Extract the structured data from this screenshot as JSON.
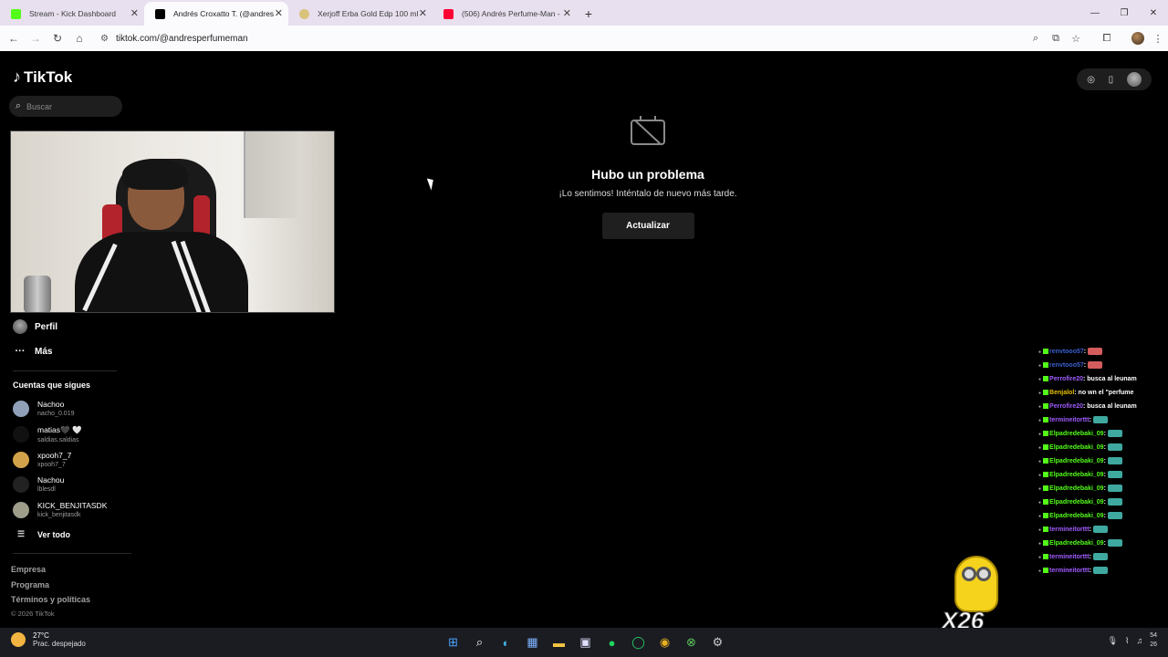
{
  "browser": {
    "tabs": [
      {
        "title": "Stream - Kick Dashboard",
        "favicon_color": "#53fc18",
        "active": false
      },
      {
        "title": "Andrés Croxatto T. (@andrespe",
        "favicon_color": "#000000",
        "active": true
      },
      {
        "title": "Xerjoff Erba Gold Edp 100 ml |",
        "favicon_color": "#d9c27a",
        "active": false
      },
      {
        "title": "(506) Andrés Perfume-Man - Yo",
        "favicon_color": "#ff0033",
        "active": false
      }
    ],
    "new_tab": "+",
    "url": "tiktok.com/@andresperfumeman"
  },
  "tiktok": {
    "logo_text": "TikTok",
    "search_placeholder": "Buscar",
    "nav": {
      "profile": "Perfil",
      "more": "Más"
    },
    "following_title": "Cuentas que sigues",
    "following": [
      {
        "name": "Nachoo",
        "handle": "nacho_0.019",
        "avatar_color": "#8fa0b8"
      },
      {
        "name": "matias🖤 🤍",
        "handle": "saldias.saldias",
        "avatar_color": "#111111"
      },
      {
        "name": "xpooh7_7",
        "handle": "xpooh7_7",
        "avatar_color": "#d2a24a"
      },
      {
        "name": "Nachou",
        "handle": "lblesdl",
        "avatar_color": "#222222"
      },
      {
        "name": "KICK_BENJITASDK",
        "handle": "kick_benjitasdk",
        "avatar_color": "#9d9d8a"
      }
    ],
    "see_all": "Ver todo",
    "footer": {
      "links": [
        "Empresa",
        "Programa",
        "Términos y políticas"
      ],
      "copyright": "© 2026 TikTok"
    },
    "error": {
      "title": "Hubo un problema",
      "message": "¡Lo sentimos! Inténtalo de nuevo más tarde.",
      "button": "Actualizar"
    }
  },
  "chat": [
    {
      "user": "renvtooo57",
      "color": "#3a5fcd",
      "text": ":"
    },
    {
      "user": "renvtooo57",
      "color": "#3a5fcd",
      "text": ":"
    },
    {
      "user": "Perrofire20",
      "color": "#a05cff",
      "text": ": busca al leunam"
    },
    {
      "user": "Benjalol",
      "color": "#e5c100",
      "text": ": no wn el \"perfume"
    },
    {
      "user": "Perrofire20",
      "color": "#a05cff",
      "text": ": busca al leunam"
    },
    {
      "user": "termineitorttt",
      "color": "#a05cff",
      "text": ":"
    },
    {
      "user": "Elpadredebaki_09",
      "color": "#53fc18",
      "text": ":"
    },
    {
      "user": "Elpadredebaki_09",
      "color": "#53fc18",
      "text": ":"
    },
    {
      "user": "Elpadredebaki_09",
      "color": "#53fc18",
      "text": ":"
    },
    {
      "user": "Elpadredebaki_09",
      "color": "#53fc18",
      "text": ":"
    },
    {
      "user": "Elpadredebaki_09",
      "color": "#53fc18",
      "text": ":"
    },
    {
      "user": "Elpadredebaki_09",
      "color": "#53fc18",
      "text": ":"
    },
    {
      "user": "Elpadredebaki_09",
      "color": "#53fc18",
      "text": ":"
    },
    {
      "user": "termineitorttt",
      "color": "#a05cff",
      "text": ":"
    },
    {
      "user": "Elpadredebaki_09",
      "color": "#53fc18",
      "text": ":"
    },
    {
      "user": "termineitorttt",
      "color": "#a05cff",
      "text": ":"
    },
    {
      "user": "termineitorttt",
      "color": "#a05cff",
      "text": ":"
    }
  ],
  "sticker": {
    "count_label": "X26"
  },
  "taskbar": {
    "weather_temp": "27°C",
    "weather_condition": "Prac. despejado",
    "clock_top": "54",
    "clock_bottom": "26"
  }
}
